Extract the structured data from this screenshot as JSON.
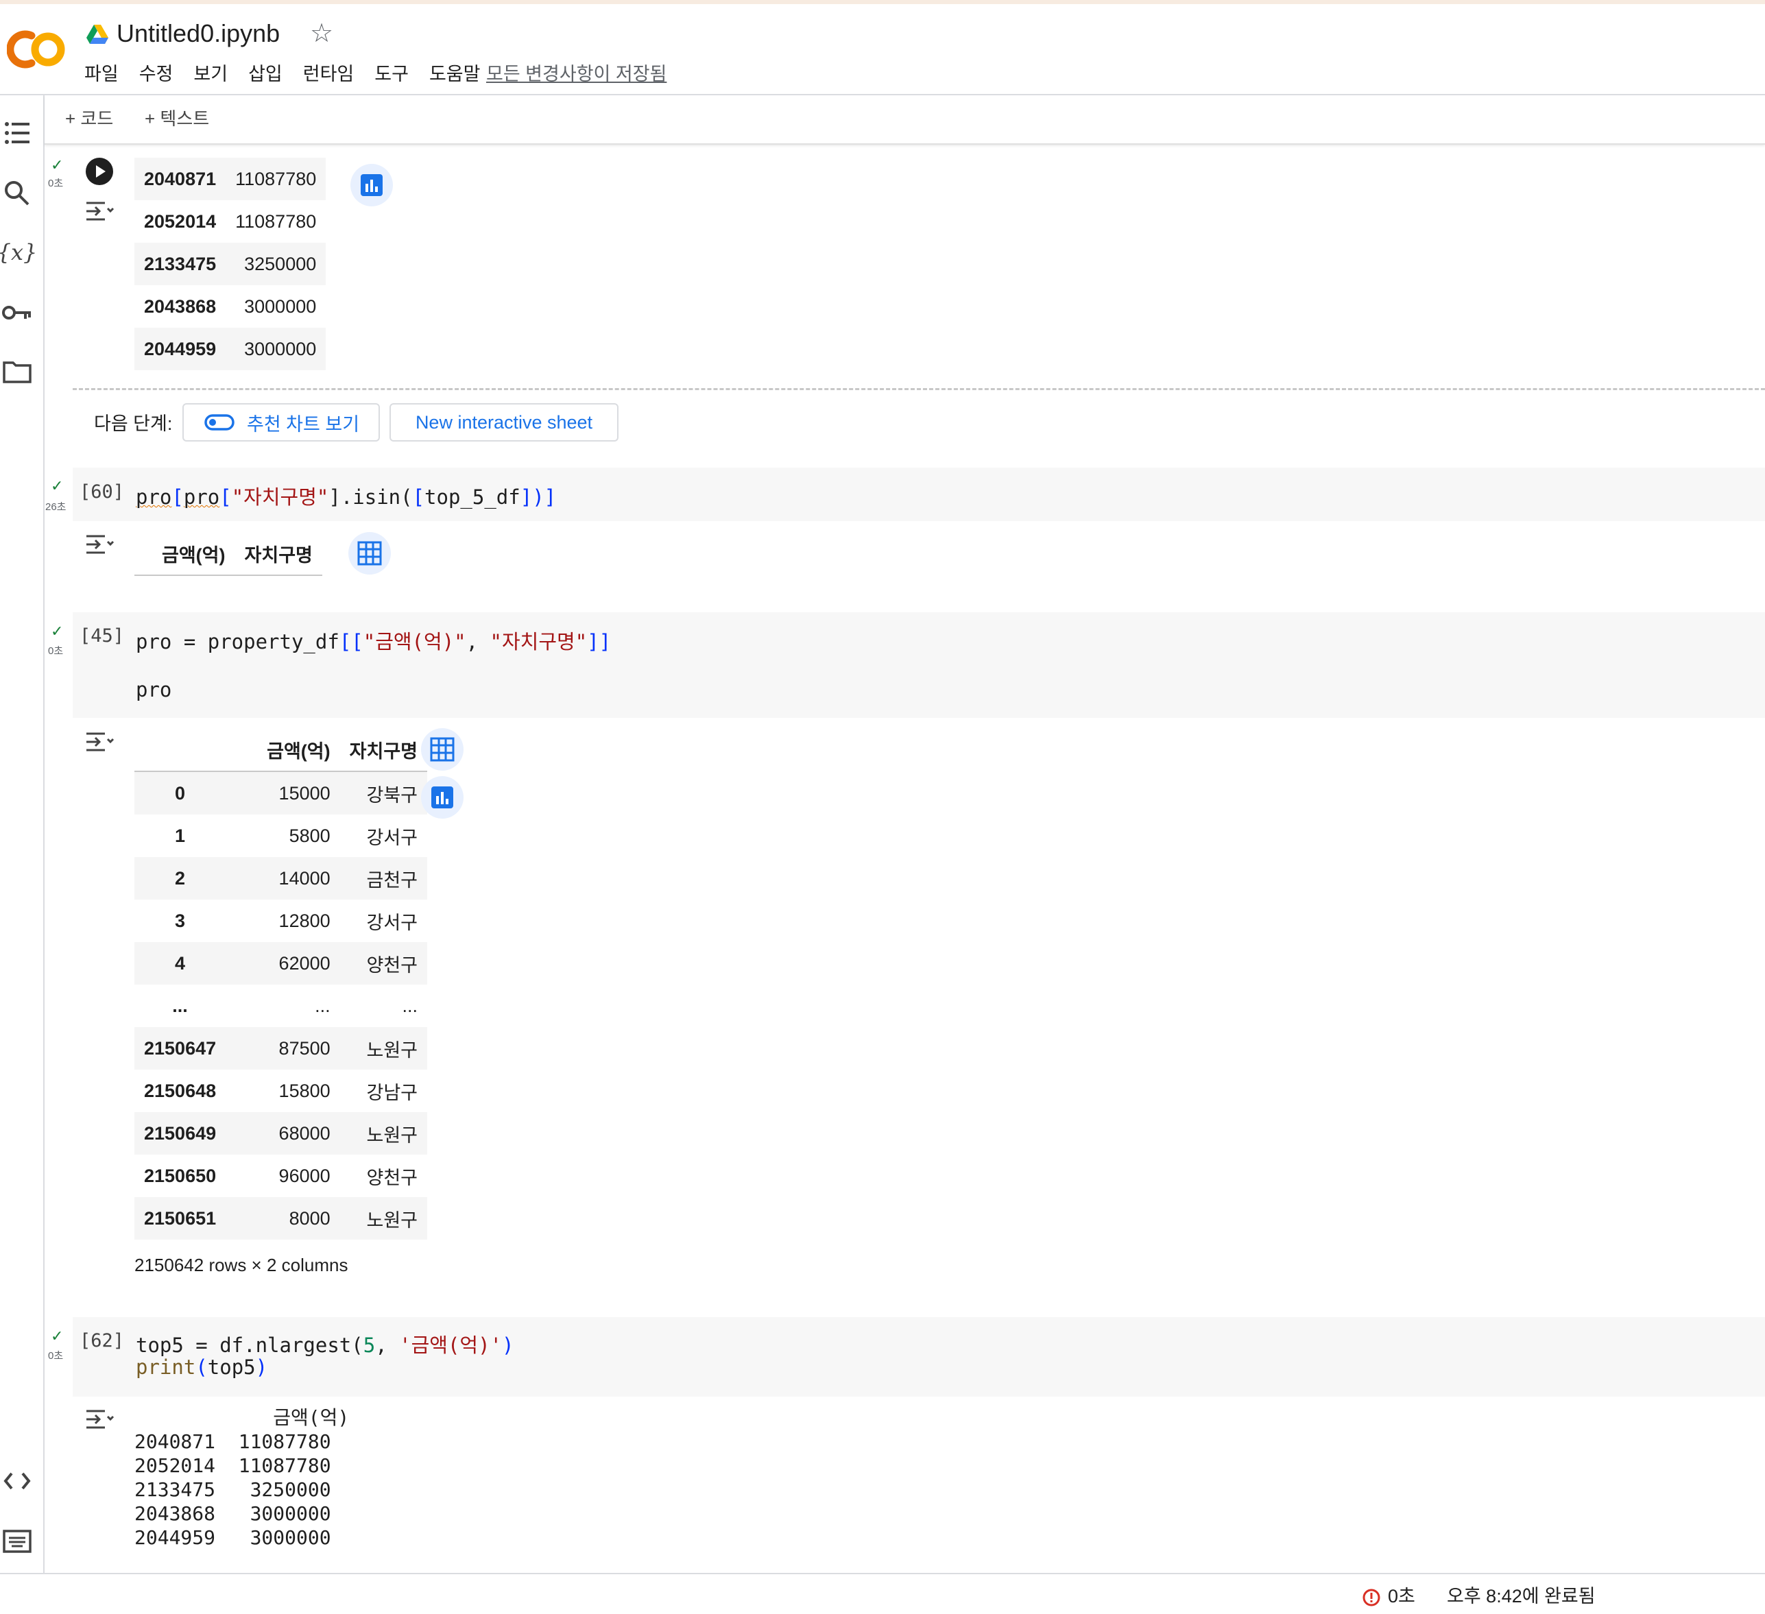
{
  "app": {
    "title": "Untitled0.ipynb",
    "menu": [
      "파일",
      "수정",
      "보기",
      "삽입",
      "런타임",
      "도구",
      "도움말"
    ],
    "saved_status": "모든 변경사항이 저장됨"
  },
  "toolbar": {
    "add_code": "+ 코드",
    "add_text": "+ 텍스트"
  },
  "cell_top": {
    "time": "0초",
    "rows": [
      [
        "2040871",
        "11087780"
      ],
      [
        "2052014",
        "11087780"
      ],
      [
        "2133475",
        "3250000"
      ],
      [
        "2043868",
        "3000000"
      ],
      [
        "2044959",
        "3000000"
      ]
    ]
  },
  "next_steps": {
    "label": "다음 단계:",
    "chart_btn": "추천 차트 보기",
    "sheet_btn": "New interactive sheet"
  },
  "cell60": {
    "count": "[60]",
    "time": "26초",
    "code": {
      "a": "pro",
      "b": "[",
      "c": "pro",
      "d": "[",
      "e": "\"자치구명\"",
      "f": "].isin(",
      "g": "[",
      "h": "top_5_df",
      "i": "])",
      "j": "]"
    },
    "headers": [
      "금액(억)",
      "자치구명"
    ]
  },
  "cell45": {
    "count": "[45]",
    "time": "0초",
    "code_line1": {
      "a": "pro = property_df",
      "b": "[[",
      "c": "\"금액(억)\"",
      "d": ", ",
      "e": "\"자치구명\"",
      "f": "]]"
    },
    "code_line2": "pro",
    "headers": [
      "",
      "금액(억)",
      "자치구명"
    ],
    "rows": [
      [
        "0",
        "15000",
        "강북구"
      ],
      [
        "1",
        "5800",
        "강서구"
      ],
      [
        "2",
        "14000",
        "금천구"
      ],
      [
        "3",
        "12800",
        "강서구"
      ],
      [
        "4",
        "62000",
        "양천구"
      ],
      [
        "...",
        "...",
        "..."
      ],
      [
        "2150647",
        "87500",
        "노원구"
      ],
      [
        "2150648",
        "15800",
        "강남구"
      ],
      [
        "2150649",
        "68000",
        "노원구"
      ],
      [
        "2150650",
        "96000",
        "양천구"
      ],
      [
        "2150651",
        "8000",
        "노원구"
      ]
    ],
    "rows_info": "2150642 rows × 2 columns"
  },
  "cell62": {
    "count": "[62]",
    "time": "0초",
    "line1": {
      "a": "top5 = df.nlargest(",
      "b": "5",
      "c": ", ",
      "d": "'금액(억)'",
      "e": ")"
    },
    "line2": {
      "a": "print",
      "b": "(",
      "c": "top5",
      "d": ")"
    },
    "output": "            금액(억)\n2040871  11087780\n2052014  11087780\n2133475   3250000\n2043868   3000000\n2044959   3000000"
  },
  "status": {
    "elapsed": "0초",
    "completed": "오후 8:42에 완료됨"
  },
  "colors": {
    "accent": "#1a73e8",
    "logo_orange": "#f9ab00",
    "logo_dark": "#e8710a",
    "success": "#188038",
    "error": "#d93025"
  }
}
